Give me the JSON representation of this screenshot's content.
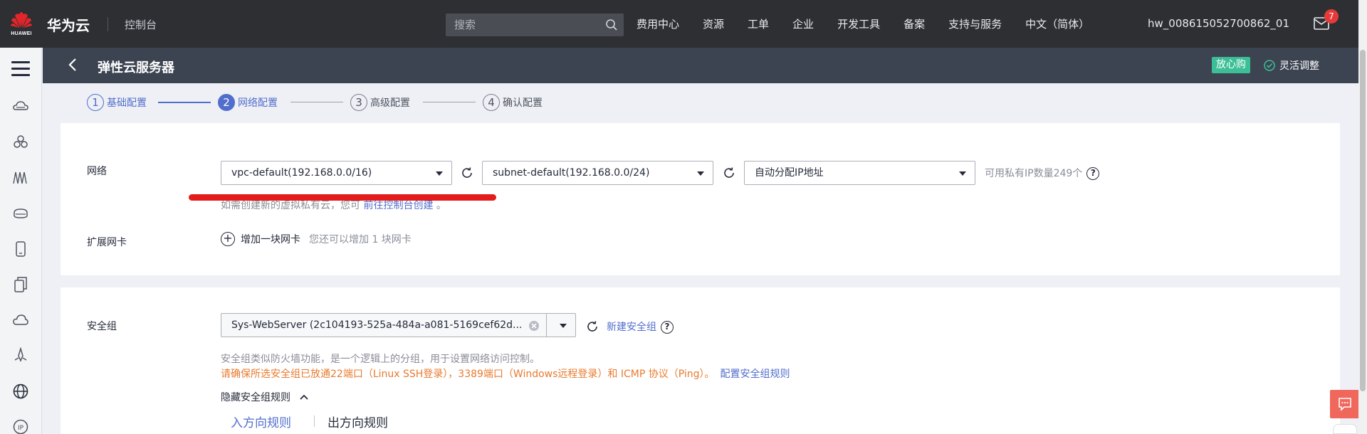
{
  "header": {
    "logo_text": "HUAWEI",
    "brand": "华为云",
    "console": "控制台",
    "search_placeholder": "搜索",
    "nav": [
      "费用中心",
      "资源",
      "工单",
      "企业",
      "开发工具",
      "备案",
      "支持与服务",
      "中文（简体）"
    ],
    "username": "hw_008615052700862_01",
    "mail_badge": "7"
  },
  "sidebar": {
    "icons": [
      "cloud-server-icon",
      "cluster-icon",
      "network-icon",
      "storage-icon",
      "mobile-icon",
      "copy-icon",
      "cloud-icon",
      "rocket-icon",
      "globe-icon",
      "ip-icon"
    ]
  },
  "subheader": {
    "title": "弹性云服务器",
    "tag": "放心购",
    "flex_adjust": "灵活调整"
  },
  "steps": [
    {
      "num": "1",
      "label": "基础配置",
      "state": "done"
    },
    {
      "num": "2",
      "label": "网络配置",
      "state": "active"
    },
    {
      "num": "3",
      "label": "高级配置",
      "state": "pending"
    },
    {
      "num": "4",
      "label": "确认配置",
      "state": "pending"
    }
  ],
  "network": {
    "label": "网络",
    "vpc": "vpc-default(192.168.0.0/16)",
    "subnet": "subnet-default(192.168.0.0/24)",
    "ip_mode": "自动分配IP地址",
    "ip_available": "可用私有IP数量249个",
    "create_hint": "如需创建新的虚拟私有云，您可",
    "create_link": "前往控制台创建",
    "create_hint_end": "。",
    "ext_nic_label": "扩展网卡",
    "add_nic": "增加一块网卡",
    "add_nic_hint": "您还可以增加 1 块网卡"
  },
  "security": {
    "label": "安全组",
    "selected": "Sys-WebServer (2c104193-525a-484a-a081-5169cef62d...",
    "new_link": "新建安全组",
    "desc": "安全组类似防火墙功能，是一个逻辑上的分组，用于设置网络访问控制。",
    "warning": "请确保所选安全组已放通22端口（Linux SSH登录），3389端口（Windows远程登录）和 ICMP 协议（Ping）。",
    "config_link": "配置安全组规则",
    "hide_rules": "隐藏安全组规则",
    "tabs": [
      "入方向规则",
      "出方向规则"
    ]
  }
}
